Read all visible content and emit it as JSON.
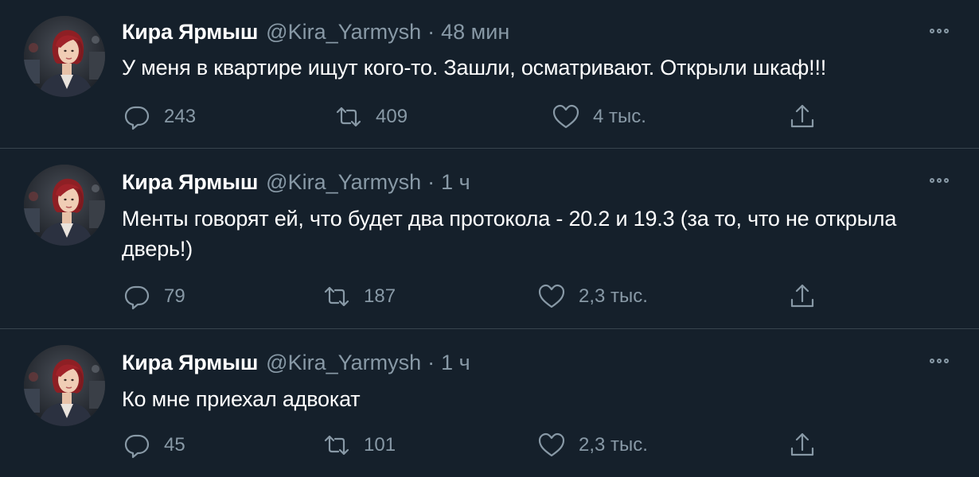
{
  "tweets": [
    {
      "name": "Кира Ярмыш",
      "handle": "@Kira_Yarmysh",
      "separator": "·",
      "time": "48 мин",
      "text": "У меня в квартире ищут кого-то. Зашли, осматривают. Открыли шкаф!!!",
      "replies": "243",
      "retweets": "409",
      "likes": "4 тыс."
    },
    {
      "name": "Кира Ярмыш",
      "handle": "@Kira_Yarmysh",
      "separator": "·",
      "time": "1 ч",
      "text": "Менты говорят ей, что будет два протокола - 20.2 и 19.3 (за то, что не открыла дверь!)",
      "replies": "79",
      "retweets": "187",
      "likes": "2,3 тыс."
    },
    {
      "name": "Кира Ярмыш",
      "handle": "@Kira_Yarmysh",
      "separator": "·",
      "time": "1 ч",
      "text": "Ко мне приехал адвокат",
      "replies": "45",
      "retweets": "101",
      "likes": "2,3 тыс."
    }
  ],
  "icons": {
    "reply": "reply-icon",
    "retweet": "retweet-icon",
    "like": "heart-icon",
    "share": "share-icon",
    "more": "more-options-icon"
  },
  "colors": {
    "background": "#15202b",
    "secondary_text": "#8899a6",
    "divider": "#38444d"
  }
}
